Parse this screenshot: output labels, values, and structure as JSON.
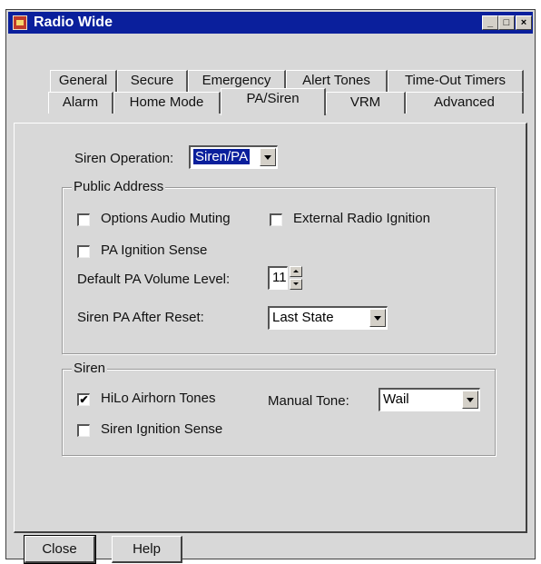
{
  "window": {
    "title": "Radio Wide"
  },
  "titlebar_buttons": {
    "minimize": "_",
    "maximize": "□",
    "close": "×"
  },
  "tabs": {
    "row1": [
      "General",
      "Secure",
      "Emergency",
      "Alert Tones",
      "Time-Out Timers"
    ],
    "row2": [
      "Alarm",
      "Home Mode",
      "PA/Siren",
      "VRM",
      "Advanced"
    ],
    "active": "PA/Siren"
  },
  "siren_operation": {
    "label": "Siren Operation:",
    "value": "Siren/PA"
  },
  "public_address": {
    "title": "Public Address",
    "options_audio_muting": {
      "label": "Options Audio Muting",
      "checked": false
    },
    "external_radio_ignition": {
      "label": "External Radio Ignition",
      "checked": false
    },
    "pa_ignition_sense": {
      "label": "PA Ignition Sense",
      "checked": false
    },
    "default_volume": {
      "label": "Default PA Volume Level:",
      "value": "11"
    },
    "after_reset": {
      "label": "Siren PA After Reset:",
      "value": "Last State"
    }
  },
  "siren": {
    "title": "Siren",
    "hilo_airhorn": {
      "label": "HiLo Airhorn Tones",
      "checked": true,
      "mark": "✔"
    },
    "siren_ignition_sense": {
      "label": "Siren Ignition Sense",
      "checked": false
    },
    "manual_tone": {
      "label": "Manual Tone:",
      "value": "Wail"
    }
  },
  "buttons": {
    "close": "Close",
    "help": "Help"
  }
}
